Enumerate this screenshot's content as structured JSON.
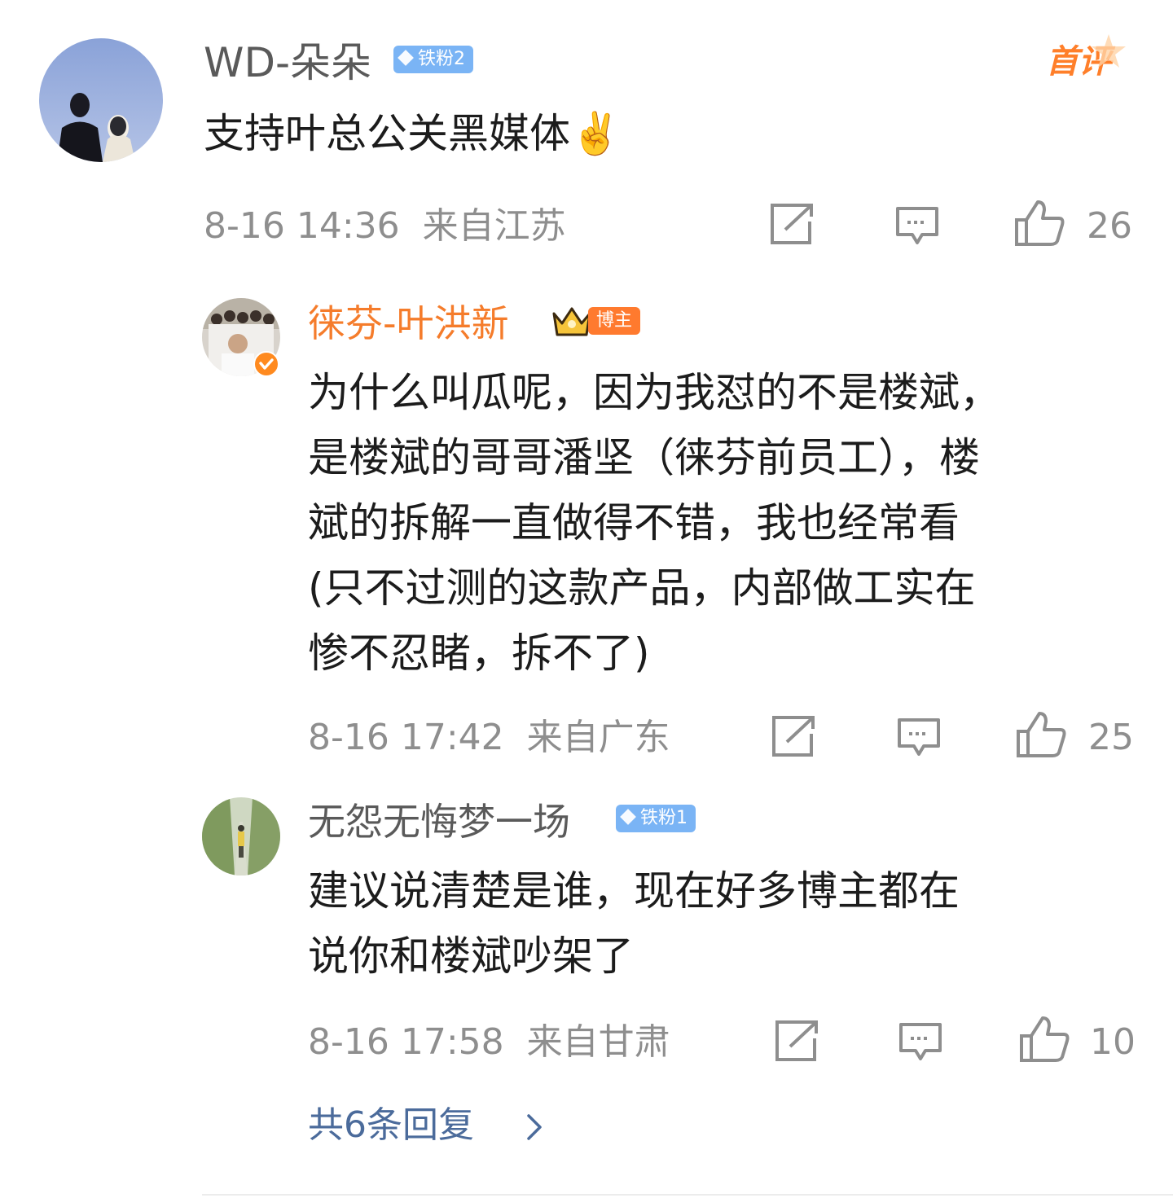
{
  "top_comment": {
    "username": "WD-朵朵",
    "badge": "铁粉2",
    "first_tag": "首评",
    "content": "支持叶总公关黑媒体",
    "emoji": "✌️",
    "time": "8-16 14:36",
    "location": "来自江苏",
    "likes": "26"
  },
  "replies": [
    {
      "username": "徕芬-叶洪新",
      "badge": "博主",
      "lines": [
        "为什么叫瓜呢，因为我怼的不是楼斌，",
        "是楼斌的哥哥潘坚（徕芬前员工），楼",
        "斌的拆解一直做得不错，我也经常看",
        "(只不过测的这款产品，内部做工实在",
        "惨不忍睹，拆不了)"
      ],
      "time": "8-16 17:42",
      "location": "来自广东",
      "likes": "25"
    },
    {
      "username": "无怨无悔梦一场",
      "badge": "铁粉1",
      "lines": [
        "建议说清楚是谁，现在好多博主都在",
        "说你和楼斌吵架了"
      ],
      "time": "8-16 17:58",
      "location": "来自甘肃",
      "likes": "10"
    }
  ],
  "more_replies": "共6条回复",
  "colors": {
    "host_name": "#f57c2b",
    "link": "#4b6b9b",
    "meta": "#8e8e8e",
    "badge_blue": "#7ab4f5",
    "badge_orange": "#ff7a2e"
  },
  "icons": [
    "share-icon",
    "comment-icon",
    "like-icon",
    "verified-icon",
    "crown-icon",
    "chevron-right-icon"
  ]
}
